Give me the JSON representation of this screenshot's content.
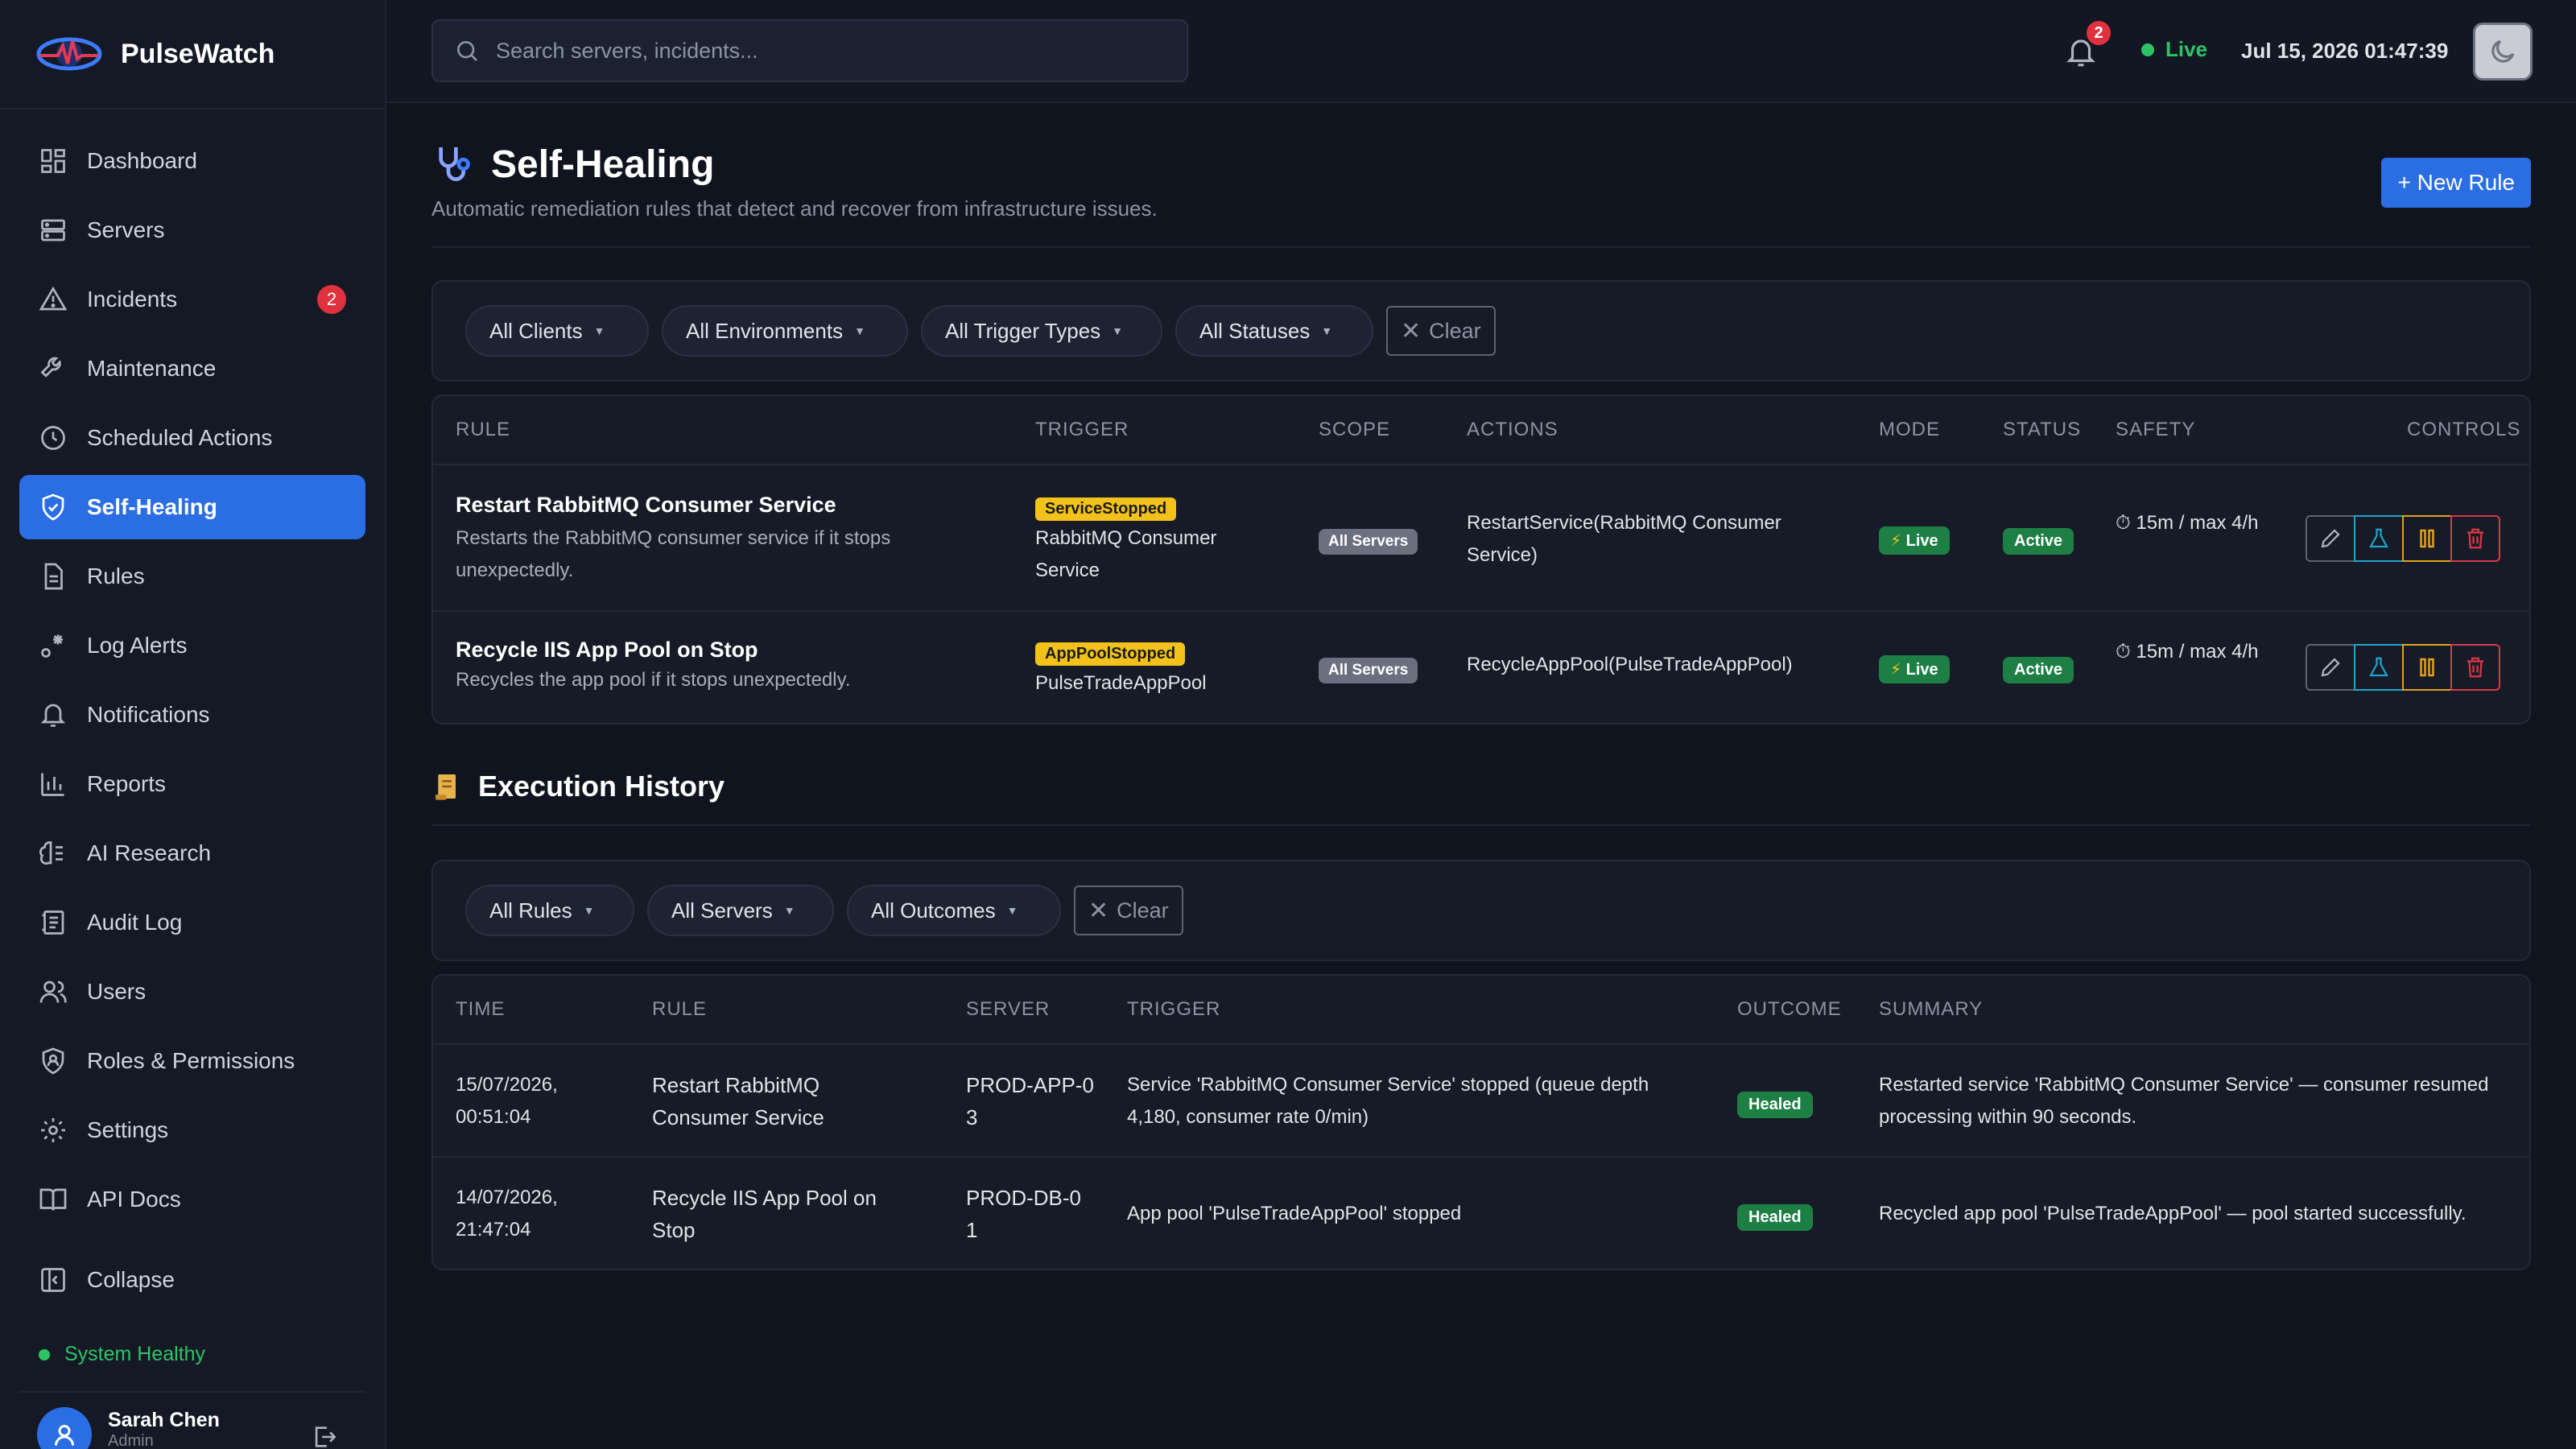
{
  "app": {
    "name": "PulseWatch"
  },
  "sidebar": {
    "items": [
      {
        "label": "Dashboard",
        "icon": "dashboard-icon"
      },
      {
        "label": "Servers",
        "icon": "server-icon"
      },
      {
        "label": "Incidents",
        "icon": "alert-triangle-icon",
        "badge": "2"
      },
      {
        "label": "Maintenance",
        "icon": "wrench-icon"
      },
      {
        "label": "Scheduled Actions",
        "icon": "clock-icon"
      },
      {
        "label": "Self-Healing",
        "icon": "shield-check-icon",
        "active": true
      },
      {
        "label": "Rules",
        "icon": "document-icon"
      },
      {
        "label": "Log Alerts",
        "icon": "log-alert-icon"
      },
      {
        "label": "Notifications",
        "icon": "bell-icon"
      },
      {
        "label": "Reports",
        "icon": "bar-chart-icon"
      },
      {
        "label": "AI Research",
        "icon": "brain-icon"
      },
      {
        "label": "Audit Log",
        "icon": "audit-log-icon"
      },
      {
        "label": "Users",
        "icon": "users-icon"
      },
      {
        "label": "Roles & Permissions",
        "icon": "shield-user-icon"
      },
      {
        "label": "Settings",
        "icon": "gear-icon"
      },
      {
        "label": "API Docs",
        "icon": "book-icon"
      }
    ],
    "collapse_label": "Collapse",
    "system_status": "System Healthy",
    "user": {
      "name": "Sarah Chen",
      "role": "Admin"
    }
  },
  "header": {
    "search_placeholder": "Search servers, incidents...",
    "notification_count": "2",
    "live_label": "Live",
    "datetime": "Jul 15, 2026 01:47:39"
  },
  "page": {
    "title": "Self-Healing",
    "subtitle": "Automatic remediation rules that detect and recover from infrastructure issues.",
    "new_rule_label": "+ New Rule"
  },
  "rule_filters": {
    "clients": "All Clients",
    "environments": "All Environments",
    "trigger_types": "All Trigger Types",
    "statuses": "All Statuses",
    "clear_label": "Clear"
  },
  "rules_table": {
    "columns": [
      "RULE",
      "TRIGGER",
      "SCOPE",
      "ACTIONS",
      "MODE",
      "STATUS",
      "SAFETY",
      "CONTROLS"
    ],
    "rows": [
      {
        "name": "Restart RabbitMQ Consumer Service",
        "description": "Restarts the RabbitMQ consumer service if it stops unexpectedly.",
        "trigger_type": "ServiceStopped",
        "trigger_target": "RabbitMQ Consumer Service",
        "scope": "All Servers",
        "action": "RestartService(RabbitMQ Consumer Service)",
        "mode": "Live",
        "status": "Active",
        "safety": "15m / max 4/h"
      },
      {
        "name": "Recycle IIS App Pool on Stop",
        "description": "Recycles the app pool if it stops unexpectedly.",
        "trigger_type": "AppPoolStopped",
        "trigger_target": "PulseTradeAppPool",
        "scope": "All Servers",
        "action": "RecycleAppPool(PulseTradeAppPool)",
        "mode": "Live",
        "status": "Active",
        "safety": "15m / max 4/h"
      }
    ]
  },
  "history": {
    "title": "Execution History",
    "filters": {
      "rules": "All Rules",
      "servers": "All Servers",
      "outcomes": "All Outcomes",
      "clear_label": "Clear"
    },
    "columns": [
      "TIME",
      "RULE",
      "SERVER",
      "TRIGGER",
      "OUTCOME",
      "SUMMARY"
    ],
    "rows": [
      {
        "time": "15/07/2026, 00:51:04",
        "rule": "Restart RabbitMQ Consumer Service",
        "server": "PROD-APP-03",
        "trigger": "Service 'RabbitMQ Consumer Service' stopped (queue depth 4,180, consumer rate 0/min)",
        "outcome": "Healed",
        "summary": "Restarted service 'RabbitMQ Consumer Service' — consumer resumed processing within 90 seconds."
      },
      {
        "time": "14/07/2026, 21:47:04",
        "rule": "Recycle IIS App Pool on Stop",
        "server": "PROD-DB-01",
        "trigger": "App pool 'PulseTradeAppPool' stopped",
        "outcome": "Healed",
        "summary": "Recycled app pool 'PulseTradeAppPool' — pool started successfully."
      }
    ]
  },
  "colors": {
    "accent": "#2b6de3",
    "live_green": "#2ec466",
    "danger": "#e0313f",
    "warning": "#f2c21a"
  }
}
